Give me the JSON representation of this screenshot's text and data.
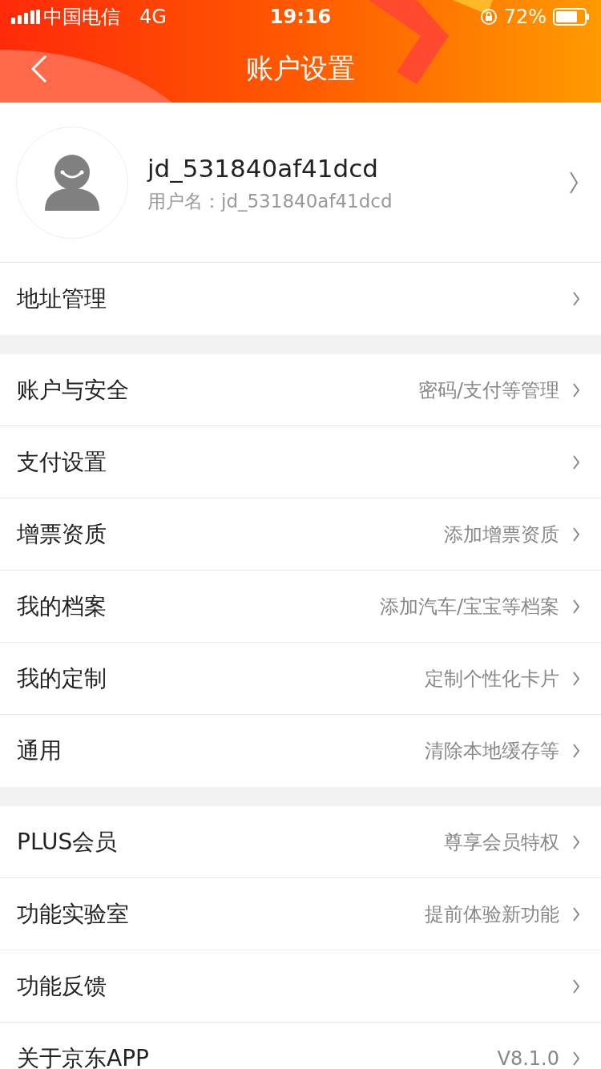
{
  "status_bar": {
    "carrier": "中国电信",
    "network": "4G",
    "time": "19:16",
    "battery": "72%"
  },
  "nav": {
    "title": "账户设置"
  },
  "profile": {
    "nickname": "jd_531840af41dcd",
    "username": "用户名：jd_531840af41dcd"
  },
  "groups": [
    {
      "items": [
        {
          "label": "地址管理"
        }
      ]
    },
    {
      "items": [
        {
          "label": "账户与安全",
          "detail": "密码/支付等管理"
        },
        {
          "label": "支付设置"
        },
        {
          "label": "增票资质",
          "detail": "添加增票资质"
        },
        {
          "label": "我的档案",
          "detail": "添加汽车/宝宝等档案"
        },
        {
          "label": "我的定制",
          "detail": "定制个性化卡片"
        },
        {
          "label": "通用",
          "detail": "清除本地缓存等"
        }
      ]
    },
    {
      "items": [
        {
          "label": "PLUS会员",
          "detail": "尊享会员特权"
        },
        {
          "label": "功能实验室",
          "detail": "提前体验新功能"
        },
        {
          "label": "功能反馈"
        },
        {
          "label": "关于京东APP",
          "detail": "V8.1.0"
        }
      ]
    }
  ]
}
